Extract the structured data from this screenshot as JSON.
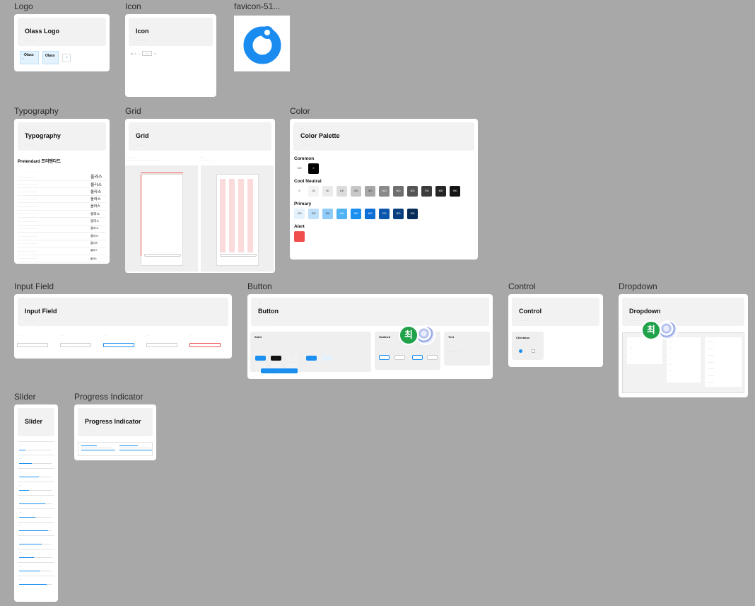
{
  "frames": {
    "logo": {
      "label": "Logo",
      "title": "Olass Logo",
      "logo_text_1": "Olass",
      "logo_text_2": "Olass"
    },
    "icon": {
      "label": "Icon",
      "title": "Icon"
    },
    "favicon": {
      "label": "favicon-51..."
    },
    "typography": {
      "label": "Typography",
      "title": "Typography",
      "font_heading": "Pretendard 프리텐다드",
      "samples": [
        "올라스",
        "올라스",
        "올라스",
        "올라스",
        "올라스",
        "올라스",
        "올라스",
        "올라스",
        "올라스",
        "올라스",
        "올라스",
        "올라스",
        "올라스"
      ]
    },
    "grid": {
      "label": "Grid",
      "title": "Grid"
    },
    "color": {
      "label": "Color",
      "title": "Color Palette",
      "common_label": "Common",
      "common": [
        {
          "name": "100",
          "hex": "#ffffff"
        },
        {
          "name": "0",
          "hex": "#000000"
        }
      ],
      "cool_label": "Cool Neutral",
      "cool": [
        {
          "name": "0",
          "hex": "#ffffff"
        },
        {
          "name": "25",
          "hex": "#f4f4f4"
        },
        {
          "name": "50",
          "hex": "#ebebeb"
        },
        {
          "name": "100",
          "hex": "#dcdcdc"
        },
        {
          "name": "200",
          "hex": "#c7c7c7"
        },
        {
          "name": "300",
          "hex": "#a7a7a7"
        },
        {
          "name": "400",
          "hex": "#8a8a8a"
        },
        {
          "name": "500",
          "hex": "#6e6e6e"
        },
        {
          "name": "600",
          "hex": "#555555"
        },
        {
          "name": "700",
          "hex": "#3c3c3c"
        },
        {
          "name": "800",
          "hex": "#262626"
        },
        {
          "name": "900",
          "hex": "#141414"
        }
      ],
      "primary_label": "Primary",
      "primary": [
        {
          "name": "100",
          "hex": "#e3f2fd"
        },
        {
          "name": "200",
          "hex": "#bde0fb"
        },
        {
          "name": "300",
          "hex": "#8ecbf8"
        },
        {
          "name": "400",
          "hex": "#4fb2f5"
        },
        {
          "name": "500",
          "hex": "#1b8ff0"
        },
        {
          "name": "600",
          "hex": "#0d6fd6"
        },
        {
          "name": "700",
          "hex": "#0a56ad"
        },
        {
          "name": "800",
          "hex": "#083f80"
        },
        {
          "name": "900",
          "hex": "#062c58"
        }
      ],
      "alert_label": "Alert",
      "alert_hex": "#f04d4d"
    },
    "input_field": {
      "label": "Input Field",
      "title": "Input Field"
    },
    "button": {
      "label": "Button",
      "title": "Button",
      "solid": "Solid",
      "outlined": "Outlined",
      "text": "Text"
    },
    "control": {
      "label": "Control",
      "title": "Control",
      "checkbox": "Checkbox"
    },
    "dropdown": {
      "label": "Dropdown",
      "title": "Dropdown"
    },
    "slider": {
      "label": "Slider",
      "title": "Slider"
    },
    "progress": {
      "label": "Progress Indicator",
      "title": "Progress Indicator"
    }
  },
  "collaborator": {
    "initial": "최"
  },
  "colors": {
    "canvas": "#a8a8a8",
    "accent": "#1b8ff0",
    "favicon": "#1a8cf0"
  }
}
